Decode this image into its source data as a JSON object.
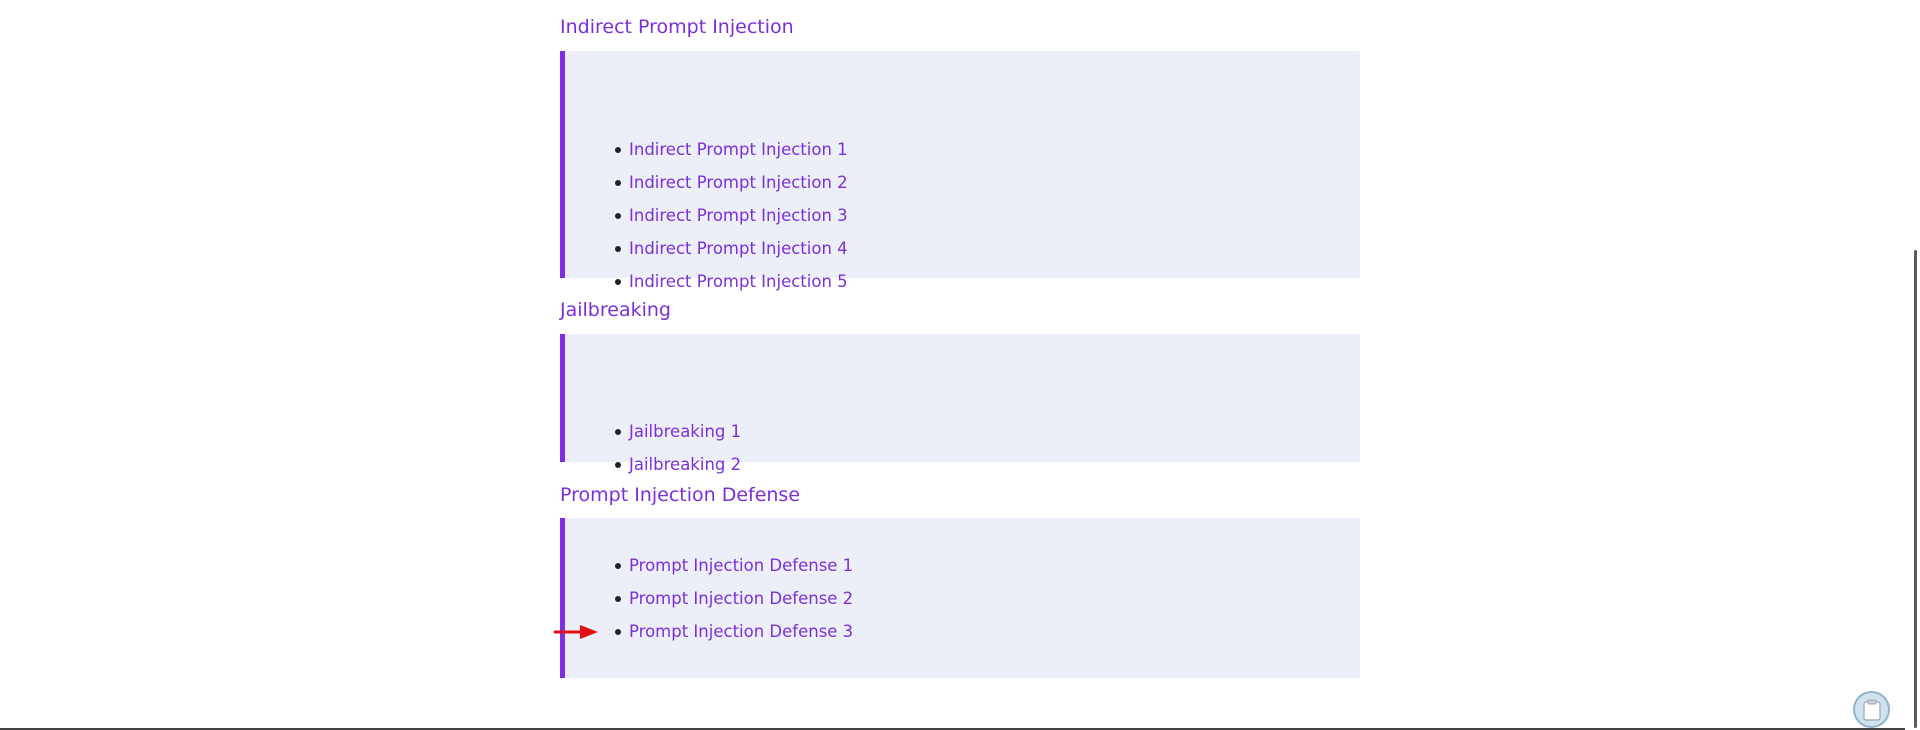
{
  "sections": [
    {
      "heading": "Indirect Prompt Injection",
      "links": [
        "Indirect Prompt Injection 1",
        "Indirect Prompt Injection 2",
        "Indirect Prompt Injection 3",
        "Indirect Prompt Injection 4",
        "Indirect Prompt Injection 5"
      ]
    },
    {
      "heading": "Jailbreaking",
      "links": [
        "Jailbreaking 1",
        "Jailbreaking 2"
      ]
    },
    {
      "heading": "Prompt Injection Defense",
      "links": [
        "Prompt Injection Defense 1",
        "Prompt Injection Defense 2",
        "Prompt Injection Defense 3"
      ]
    }
  ],
  "colors": {
    "accent": "#7c2fd9",
    "box_background": "#eceff8",
    "box_border": "#7c2fe5",
    "pointer_arrow": "#e01010"
  },
  "icons": {
    "pointer": "red-arrow-icon",
    "floating_button": "clipboard-icon"
  }
}
